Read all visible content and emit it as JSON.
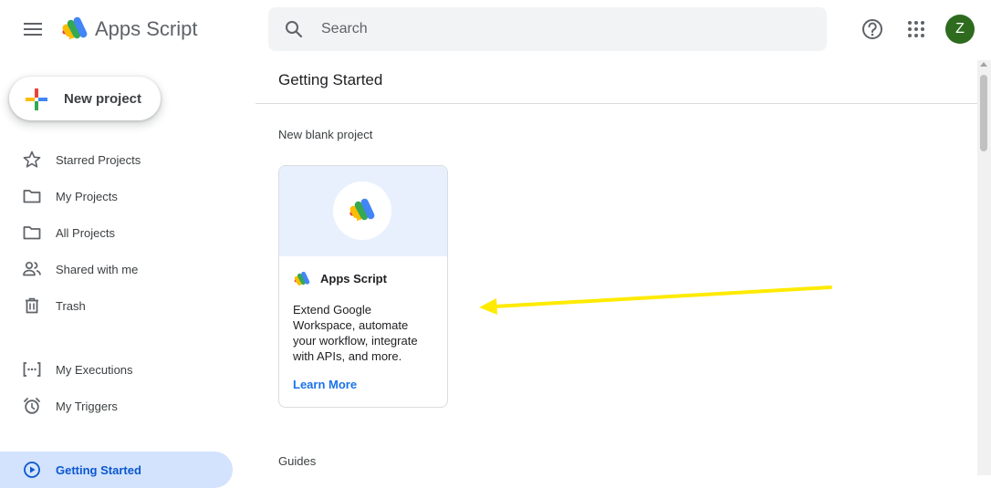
{
  "header": {
    "app_title": "Apps Script",
    "search": {
      "placeholder": "Search",
      "value": ""
    },
    "avatar_initial": "Z"
  },
  "sidebar": {
    "new_project_label": "New project",
    "items": [
      {
        "label": "Starred Projects",
        "icon": "star-icon"
      },
      {
        "label": "My Projects",
        "icon": "folder-icon"
      },
      {
        "label": "All Projects",
        "icon": "folder-icon"
      },
      {
        "label": "Shared with me",
        "icon": "people-icon"
      },
      {
        "label": "Trash",
        "icon": "trash-icon"
      }
    ],
    "secondary_items": [
      {
        "label": "My Executions",
        "icon": "executions-icon"
      },
      {
        "label": "My Triggers",
        "icon": "alarm-clock-icon"
      }
    ],
    "active_item": {
      "label": "Getting Started",
      "icon": "play-circle-icon"
    }
  },
  "main": {
    "title": "Getting Started",
    "new_blank_project_label": "New blank project",
    "card": {
      "title": "Apps Script",
      "description": "Extend Google Workspace, automate your workflow, integrate with APIs, and more.",
      "link_label": "Learn More"
    },
    "guides_label": "Guides"
  },
  "colors": {
    "active_bg": "#d3e3fd",
    "active_text": "#0b57d0",
    "link": "#1a73e8",
    "avatar_bg": "#2e6b1e",
    "annotation_arrow": "#ffea00"
  }
}
